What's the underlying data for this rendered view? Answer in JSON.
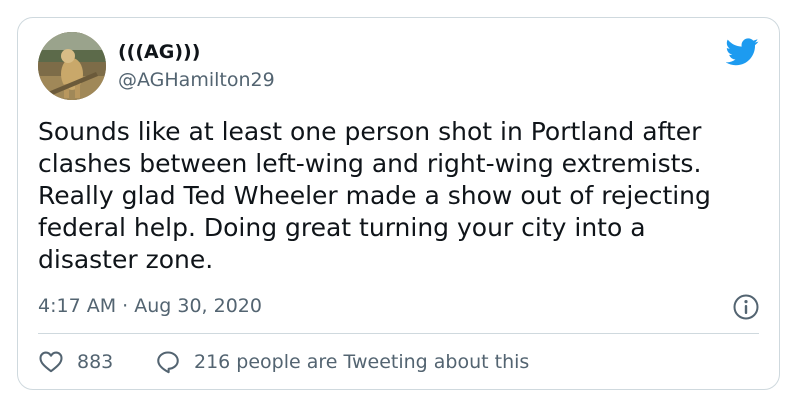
{
  "tweet": {
    "display_name": "(((AG)))",
    "handle": "@AGHamilton29",
    "text": "Sounds like at least one person shot in Portland after\nclashes between left-wing and right-wing extremists.\nReally glad Ted Wheeler made a show out of rejecting\nfederal help. Doing great turning your city into a\ndisaster zone.",
    "timestamp": "4:17 AM · Aug 30, 2020",
    "like_count": "883",
    "conversation_text": "216 people are Tweeting about this"
  },
  "icons": {
    "brand": "twitter-bird-icon",
    "info": "info-icon",
    "like": "heart-icon",
    "reply": "speech-bubble-icon"
  },
  "colors": {
    "brand_blue": "#1d9bf0",
    "text_primary": "#0f1419",
    "text_secondary": "#536471",
    "border": "#cfd9de"
  }
}
